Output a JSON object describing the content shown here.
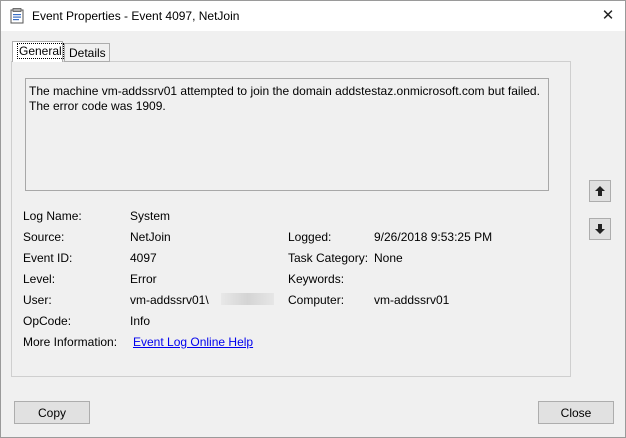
{
  "window": {
    "title": "Event Properties - Event 4097, NetJoin",
    "close_glyph": "✕"
  },
  "tabs": [
    {
      "label": "General",
      "active": true
    },
    {
      "label": "Details",
      "active": false
    }
  ],
  "description": {
    "line1": "The machine vm-addssrv01 attempted to join the domain addstestaz.onmicrosoft.com but failed.",
    "line2": "The error code was 1909."
  },
  "fields": {
    "log_name": {
      "label": "Log Name:",
      "value": "System"
    },
    "source": {
      "label": "Source:",
      "value": "NetJoin"
    },
    "event_id": {
      "label": "Event ID:",
      "value": "4097"
    },
    "level": {
      "label": "Level:",
      "value": "Error"
    },
    "user": {
      "label": "User:",
      "value": "vm-addssrv01\\"
    },
    "opcode": {
      "label": "OpCode:",
      "value": "Info"
    },
    "more_info": {
      "label": "More Information:",
      "value": "Event Log Online Help"
    },
    "logged": {
      "label": "Logged:",
      "value": "9/26/2018 9:53:25 PM"
    },
    "task_category": {
      "label": "Task Category:",
      "value": "None"
    },
    "keywords": {
      "label": "Keywords:",
      "value": ""
    },
    "computer": {
      "label": "Computer:",
      "value": "vm-addssrv01"
    }
  },
  "buttons": {
    "copy": "Copy",
    "close": "Close"
  },
  "icons": {
    "title": "event-viewer-icon",
    "up": "arrow-up-icon",
    "down": "arrow-down-icon"
  }
}
